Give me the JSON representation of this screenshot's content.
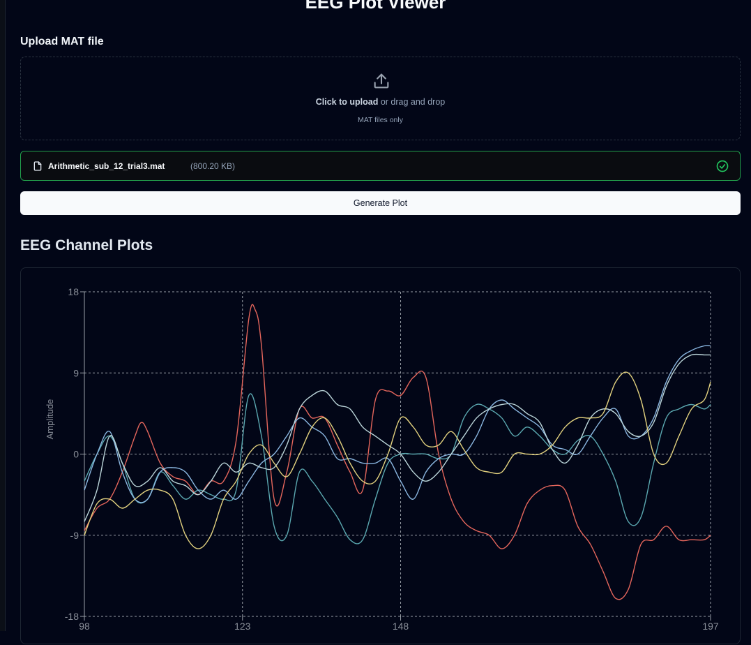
{
  "page": {
    "title": "EEG Plot Viewer"
  },
  "upload": {
    "label": "Upload MAT file",
    "click_text": "Click to upload",
    "drag_text": " or drag and drop",
    "hint": "MAT files only",
    "icon": "upload-icon"
  },
  "file": {
    "name": "Arithmetic_sub_12_trial3.mat",
    "size": "(800.20 KB)",
    "status_icon": "check-circle-icon",
    "status_color": "#22c55e"
  },
  "actions": {
    "generate_label": "Generate Plot"
  },
  "plots": {
    "section_title": "EEG Channel Plots"
  },
  "chart_data": {
    "type": "line",
    "title": "",
    "xlabel": "",
    "ylabel": "Amplitude",
    "xlim": [
      98,
      197
    ],
    "ylim": [
      -18,
      18
    ],
    "x_ticks": [
      "98",
      "123",
      "148",
      "197"
    ],
    "y_ticks": [
      "18",
      "9",
      "0",
      "-9",
      "-18"
    ],
    "grid": true,
    "series": [
      {
        "color": "#e5665c",
        "x": [
          98,
          100,
          102,
          104,
          106,
          107,
          108,
          110,
          112,
          114,
          116,
          118,
          120,
          122,
          124,
          125,
          126,
          128,
          130,
          132,
          134,
          136,
          138,
          140,
          142,
          144,
          146,
          148,
          150,
          152,
          154,
          156,
          158,
          160,
          162,
          164,
          166,
          168,
          170,
          172,
          174,
          176,
          178,
          180,
          182,
          184,
          186,
          188,
          190,
          192,
          194,
          196,
          197
        ],
        "y": [
          -8.5,
          -6,
          -5,
          -2,
          2,
          3.5,
          2.5,
          -1,
          -2.5,
          -3,
          -4.5,
          -3,
          -3,
          1.5,
          15,
          16,
          12,
          -5,
          -2,
          5,
          4,
          4,
          1,
          -2,
          -4,
          6,
          7,
          6.5,
          8.5,
          8.5,
          0,
          -5,
          -7.5,
          -8.5,
          -9,
          -10.5,
          -9,
          -5.5,
          -4,
          -3.5,
          -4,
          -8,
          -10,
          -13,
          -16,
          -15,
          -10,
          -9.5,
          -8,
          -9.5,
          -9.5,
          -9.5,
          -9
        ]
      },
      {
        "color": "#5ba8b0",
        "x": [
          98,
          100,
          102,
          104,
          106,
          108,
          110,
          112,
          114,
          116,
          118,
          120,
          122,
          124,
          126,
          128,
          130,
          132,
          134,
          136,
          138,
          140,
          142,
          144,
          146,
          148,
          150,
          152,
          154,
          156,
          158,
          160,
          162,
          164,
          166,
          168,
          170,
          172,
          174,
          176,
          178,
          180,
          182,
          184,
          186,
          188,
          190,
          192,
          194,
          196,
          197
        ],
        "y": [
          -3,
          0,
          2,
          -1,
          -5,
          -5,
          -2,
          -3.5,
          -5,
          -4,
          -4.5,
          -5,
          -4,
          6.5,
          2,
          -8,
          -9,
          -2,
          -3,
          -5,
          -7,
          -9.5,
          -9.5,
          -5,
          -1,
          0,
          0,
          0,
          -0.5,
          0,
          4,
          5.5,
          5,
          4,
          2,
          3,
          2,
          0.5,
          0,
          1.5,
          2,
          0,
          -3,
          -7.5,
          -7,
          -1,
          4,
          5,
          5.5,
          5,
          5.5
        ]
      },
      {
        "color": "#8ab6e0",
        "x": [
          98,
          100,
          102,
          104,
          106,
          108,
          110,
          112,
          114,
          116,
          118,
          120,
          122,
          124,
          126,
          128,
          130,
          132,
          134,
          136,
          138,
          140,
          142,
          144,
          146,
          148,
          150,
          152,
          154,
          156,
          158,
          160,
          162,
          164,
          166,
          168,
          170,
          172,
          174,
          176,
          178,
          180,
          182,
          184,
          186,
          188,
          190,
          192,
          194,
          196,
          197
        ],
        "y": [
          -4,
          0,
          2.5,
          -2,
          -5,
          -5,
          -2,
          -1.5,
          -2,
          -4,
          -5,
          -4,
          -5,
          -3,
          -1,
          0,
          2,
          4,
          3,
          2,
          -0.5,
          -0.5,
          -1,
          -1,
          -0.5,
          -3,
          -5,
          -2,
          -0.5,
          0,
          0,
          2,
          5,
          6,
          5,
          4,
          3,
          1,
          0.5,
          0,
          2,
          4,
          5,
          2,
          2,
          4,
          8,
          10.5,
          11.5,
          12,
          12
        ]
      },
      {
        "color": "#bcd6da",
        "x": [
          98,
          100,
          102,
          104,
          106,
          108,
          110,
          112,
          114,
          116,
          118,
          120,
          122,
          124,
          126,
          128,
          130,
          132,
          134,
          136,
          138,
          140,
          142,
          144,
          146,
          148,
          150,
          152,
          154,
          156,
          158,
          160,
          162,
          164,
          166,
          168,
          170,
          172,
          174,
          176,
          178,
          180,
          182,
          184,
          186,
          188,
          190,
          192,
          194,
          196,
          197
        ],
        "y": [
          -7.5,
          -4,
          2,
          -1,
          -3.5,
          -3,
          -1.5,
          -3,
          -3.5,
          -4.5,
          -3,
          -1,
          -2,
          -1,
          -1.5,
          -1.5,
          1,
          5,
          6.5,
          7,
          5.5,
          5,
          3,
          2,
          1,
          0,
          -2,
          -3,
          -2,
          0,
          2,
          4,
          5,
          5.5,
          5.5,
          4.5,
          3.5,
          0.5,
          -1,
          1,
          4,
          5,
          4.5,
          2.5,
          2,
          3.5,
          7.5,
          10,
          11,
          11,
          11
        ]
      },
      {
        "color": "#e3d27f",
        "x": [
          98,
          100,
          102,
          104,
          106,
          108,
          110,
          112,
          114,
          116,
          118,
          120,
          122,
          124,
          126,
          128,
          130,
          132,
          134,
          136,
          138,
          140,
          142,
          144,
          146,
          148,
          150,
          152,
          154,
          156,
          158,
          160,
          162,
          164,
          166,
          168,
          170,
          172,
          174,
          176,
          178,
          180,
          182,
          184,
          186,
          188,
          190,
          192,
          194,
          196,
          197
        ],
        "y": [
          -9,
          -5.5,
          -5,
          -6,
          -5,
          -4,
          -4,
          -5,
          -9,
          -10.5,
          -9,
          -5,
          -3,
          0,
          1,
          -1,
          -2.5,
          0,
          3,
          4,
          2,
          -1,
          -3,
          -3,
          0,
          4,
          3,
          1,
          1,
          2.5,
          0.5,
          -1.5,
          -2,
          -2,
          0,
          0,
          0,
          1,
          3,
          4,
          4,
          4.5,
          8,
          9,
          6,
          0,
          -1,
          2,
          5,
          6,
          8
        ]
      }
    ]
  }
}
